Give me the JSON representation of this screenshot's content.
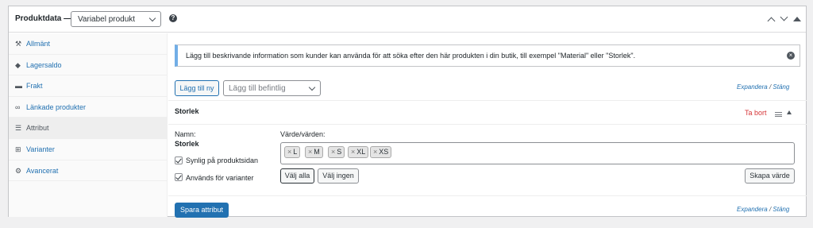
{
  "header": {
    "title": "Produktdata —",
    "product_type": "Variabel produkt",
    "help": "?"
  },
  "sidebar": {
    "items": [
      {
        "label": "Allmänt",
        "icon": "wrench-icon",
        "glyph": "⚒"
      },
      {
        "label": "Lagersaldo",
        "icon": "tag-icon",
        "glyph": "◆"
      },
      {
        "label": "Frakt",
        "icon": "truck-icon",
        "glyph": "▬"
      },
      {
        "label": "Länkade produkter",
        "icon": "link-icon",
        "glyph": "∞"
      },
      {
        "label": "Attribut",
        "icon": "list-icon",
        "glyph": "☰"
      },
      {
        "label": "Varianter",
        "icon": "grid-icon",
        "glyph": "⊞"
      },
      {
        "label": "Avancerat",
        "icon": "gear-icon",
        "glyph": "⚙"
      }
    ],
    "active": "Attribut"
  },
  "main": {
    "notice": "Lägg till beskrivande information som kunder kan använda för att söka efter den här produkten i din butik, till exempel \"Material\" eller \"Storlek\".",
    "dismiss": "×",
    "add_new_label": "Lägg till ny",
    "add_existing_placeholder": "Lägg till befintlig",
    "expand_label": "Expandera",
    "close_label": "Stäng",
    "slash": "/",
    "attribute": {
      "name": "Storlek",
      "remove_label": "Ta bort",
      "name_label": "Namn:",
      "name_value": "Storlek",
      "values_label": "Värde/värden:",
      "values": [
        "L",
        "M",
        "S",
        "XL",
        "XS"
      ],
      "visible_label": "Synlig på produktsidan",
      "variations_label": "Används för varianter",
      "visible_checked": true,
      "variations_checked": true,
      "select_all_label": "Välj alla",
      "select_none_label": "Välj ingen",
      "create_value_label": "Skapa värde"
    },
    "save_label": "Spara attribut"
  },
  "colors": {
    "accent": "#2271b1",
    "danger": "#d63638"
  }
}
